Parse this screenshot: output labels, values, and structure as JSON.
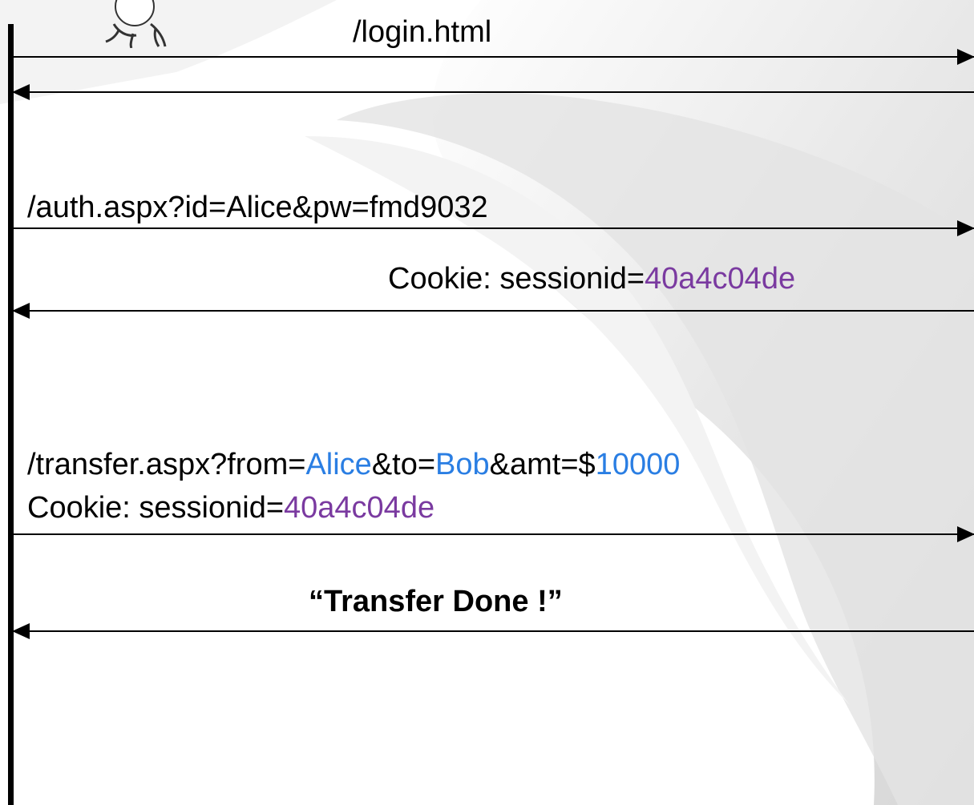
{
  "messages": {
    "login_request": "/login.html",
    "auth_request": "/auth.aspx?id=Alice&pw=fmd9032",
    "auth_response": {
      "prefix": "Cookie: sessionid=",
      "session_id": "40a4c04de"
    },
    "transfer_request": {
      "line1": {
        "part1": "/transfer.aspx?from=",
        "from": "Alice",
        "part2": "&to=",
        "to": "Bob",
        "part3": "&amt=$",
        "amount": "10000"
      },
      "line2": {
        "prefix": "Cookie: sessionid=",
        "session_id": "40a4c04de"
      }
    },
    "transfer_response": "“Transfer Done !”"
  },
  "colors": {
    "param_value": "#2a7ee3",
    "session_id": "#7a3aa0",
    "text": "#000000"
  },
  "icons": {
    "client": "user-figure-icon"
  }
}
